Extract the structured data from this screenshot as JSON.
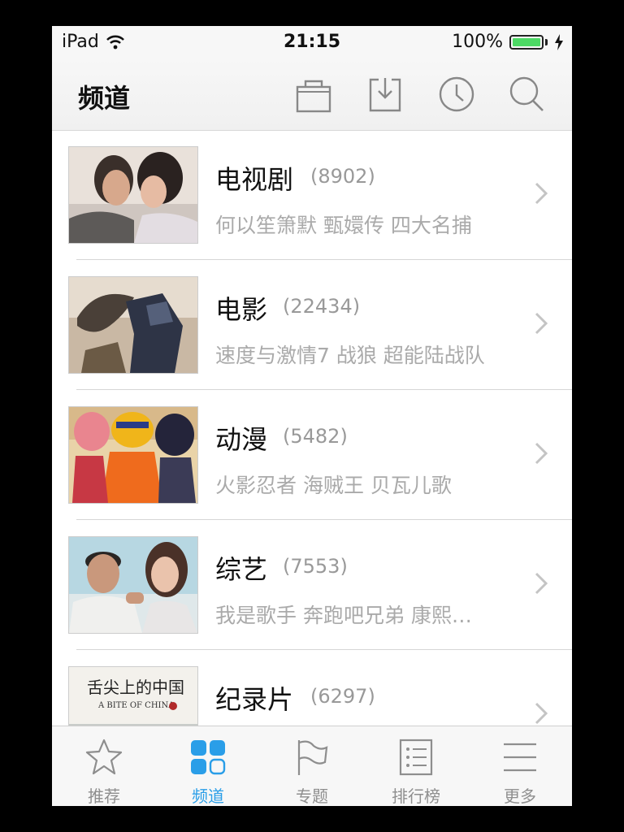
{
  "status": {
    "device": "iPad",
    "time": "21:15",
    "battery": "100%",
    "battery_level": 1.0
  },
  "nav": {
    "title": "频道"
  },
  "channels": [
    {
      "title": "电视剧",
      "count": "(8902)",
      "subtitle": "何以笙箫默 甄嬛传 四大名捕"
    },
    {
      "title": "电影",
      "count": "(22434)",
      "subtitle": "速度与激情7 战狼 超能陆战队"
    },
    {
      "title": "动漫",
      "count": "(5482)",
      "subtitle": "火影忍者 海贼王 贝瓦儿歌"
    },
    {
      "title": "综艺",
      "count": "(7553)",
      "subtitle": "我是歌手 奔跑吧兄弟 康熙…"
    },
    {
      "title": "纪录片",
      "count": "(6297)",
      "subtitle": "",
      "thumb_text": "舌尖上的中国",
      "thumb_text_en": "A BITE OF CHINA"
    }
  ],
  "tabs": [
    {
      "label": "推荐",
      "icon": "star-icon"
    },
    {
      "label": "频道",
      "icon": "grid-icon"
    },
    {
      "label": "专题",
      "icon": "flag-icon"
    },
    {
      "label": "排行榜",
      "icon": "list-icon"
    },
    {
      "label": "更多",
      "icon": "menu-icon"
    }
  ],
  "colors": {
    "accent": "#2a9ee8",
    "battery": "#4cd964"
  }
}
